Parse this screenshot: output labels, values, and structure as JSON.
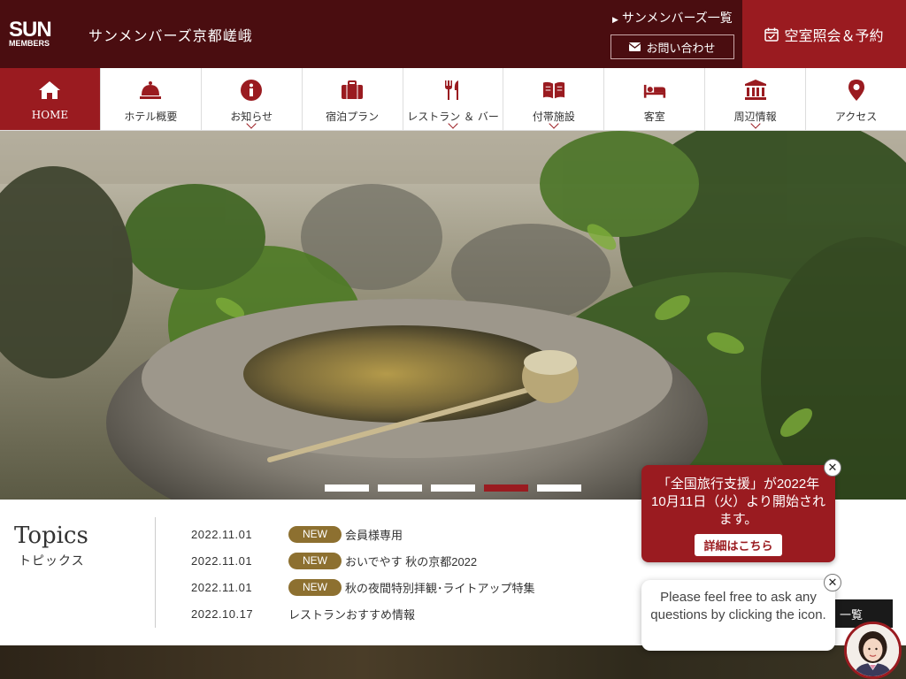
{
  "header": {
    "logo_sun": "SUN",
    "logo_members": "MEMBERS",
    "hotel_name": "サンメンバーズ京都嵯峨",
    "list_link": "サンメンバーズ一覧",
    "contact_label": "お問い合わせ",
    "reserve_label": "空室照会＆予約"
  },
  "nav": {
    "items": [
      {
        "label": "HOME",
        "icon": "home-icon"
      },
      {
        "label": "ホテル概要",
        "icon": "bell-icon"
      },
      {
        "label": "お知らせ",
        "icon": "info-icon"
      },
      {
        "label": "宿泊プラン",
        "icon": "suitcase-icon"
      },
      {
        "label": "レストラン ＆ バー",
        "icon": "fork-knife-icon"
      },
      {
        "label": "付帯施設",
        "icon": "book-icon"
      },
      {
        "label": "客室",
        "icon": "bed-icon"
      },
      {
        "label": "周辺情報",
        "icon": "landmark-icon"
      },
      {
        "label": "アクセス",
        "icon": "map-pin-icon"
      }
    ]
  },
  "slider": {
    "count": 5,
    "active_index": 3
  },
  "topics": {
    "title": "Topics",
    "subtitle": "トピックス",
    "news": [
      {
        "date": "2022.11.01",
        "badge": "NEW",
        "title": "会員様専用"
      },
      {
        "date": "2022.11.01",
        "badge": "NEW",
        "title": "おいでやす 秋の京都2022"
      },
      {
        "date": "2022.11.01",
        "badge": "NEW",
        "title": "秋の夜間特別拝観･ライトアップ特集"
      },
      {
        "date": "2022.10.17",
        "badge": "",
        "title": "レストランおすすめ情報"
      }
    ],
    "more_label": "一覧"
  },
  "promo": {
    "text": "「全国旅行支援」が2022年10月11日（火）より開始されます。",
    "detail_label": "詳細はこちら"
  },
  "chat": {
    "text": "Please feel free to ask any questions by clicking the icon."
  },
  "colors": {
    "header_bg": "#4a0d10",
    "accent": "#9a1b20",
    "badge": "#8d7030"
  }
}
